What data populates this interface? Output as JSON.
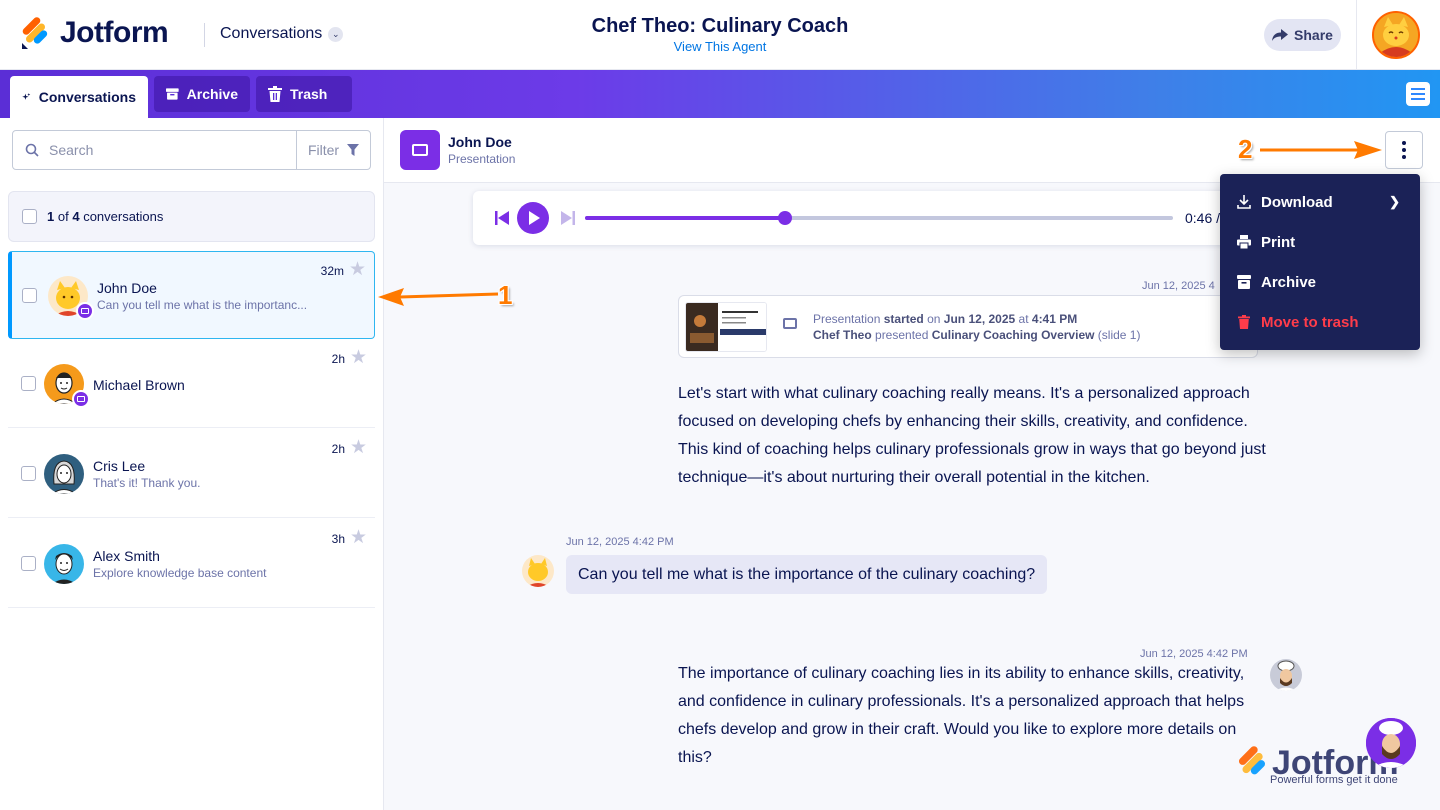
{
  "header": {
    "brand": "Jotform",
    "nav_label": "Conversations",
    "agent_title": "Chef Theo: Culinary Coach",
    "agent_link": "View This Agent",
    "share_label": "Share"
  },
  "tabs": [
    {
      "label": "Conversations",
      "icon": "sparkles-icon",
      "active": true
    },
    {
      "label": "Archive",
      "icon": "archive-icon",
      "active": false
    },
    {
      "label": "Trash",
      "icon": "trash-icon",
      "active": false
    }
  ],
  "sidebar": {
    "search_placeholder": "Search",
    "filter_label": "Filter",
    "count": {
      "selected": "1",
      "of": "of",
      "total": "4",
      "suffix": "conversations"
    },
    "conversations": [
      {
        "name": "John Doe",
        "preview": "Can you tell me what is the importanc...",
        "time": "32m",
        "selected": true,
        "has_badge": true
      },
      {
        "name": "Michael Brown",
        "preview": "",
        "time": "2h",
        "selected": false,
        "has_badge": true
      },
      {
        "name": "Cris Lee",
        "preview": "That's it! Thank you.",
        "time": "2h",
        "selected": false,
        "has_badge": false
      },
      {
        "name": "Alex Smith",
        "preview": "Explore knowledge base content",
        "time": "3h",
        "selected": false,
        "has_badge": false
      }
    ]
  },
  "conversation": {
    "name": "John Doe",
    "type": "Presentation",
    "player": {
      "time": "0:46 /",
      "progress": 0.34
    },
    "presentation_card": {
      "timestamp": "Jun 12, 2025 4",
      "line1_a": "Presentation",
      "line1_b": "started",
      "line1_c": "on",
      "line1_d": "Jun 12, 2025",
      "line1_e": "at",
      "line1_f": "4:41 PM",
      "line2_a": "Chef Theo",
      "line2_b": "presented",
      "line2_c": "Culinary Coaching Overview",
      "line2_d": "(slide 1)"
    },
    "messages": [
      {
        "role": "agent",
        "lines": [
          "Let's start with what culinary coaching really means. It's a personalized approach",
          "focused on developing chefs by enhancing their skills, creativity, and confidence.",
          "This kind of coaching helps culinary professionals grow in ways that go beyond just",
          "technique—it's about nurturing their overall potential in the kitchen."
        ]
      },
      {
        "role": "user",
        "timestamp": "Jun 12, 2025 4:42 PM",
        "text": "Can you tell me what is the importance of the culinary coaching?"
      },
      {
        "role": "agent",
        "timestamp": "Jun 12, 2025 4:42 PM",
        "lines": [
          "The importance of culinary coaching lies in its ability to enhance skills, creativity,",
          "and confidence in culinary professionals. It's a personalized approach that helps",
          "chefs develop and grow in their craft. Would you like to explore more details on",
          "this?"
        ]
      }
    ]
  },
  "menu": {
    "items": [
      {
        "label": "Download",
        "icon": "download-icon",
        "danger": false,
        "submenu": true
      },
      {
        "label": "Print",
        "icon": "printer-icon",
        "danger": false,
        "submenu": false
      },
      {
        "label": "Archive",
        "icon": "archive-icon",
        "danger": false,
        "submenu": false
      },
      {
        "label": "Move to trash",
        "icon": "trash-icon",
        "danger": true,
        "submenu": false
      }
    ]
  },
  "annotations": {
    "one": "1",
    "two": "2"
  },
  "watermark": {
    "brand": "Jotform",
    "tagline": "Powerful forms get it done"
  },
  "colors": {
    "accent": "#7b2ee6",
    "link": "#0075e3",
    "danger": "#ff3c4a",
    "annotation": "#ff7a00",
    "menu_bg": "#1b2257"
  }
}
